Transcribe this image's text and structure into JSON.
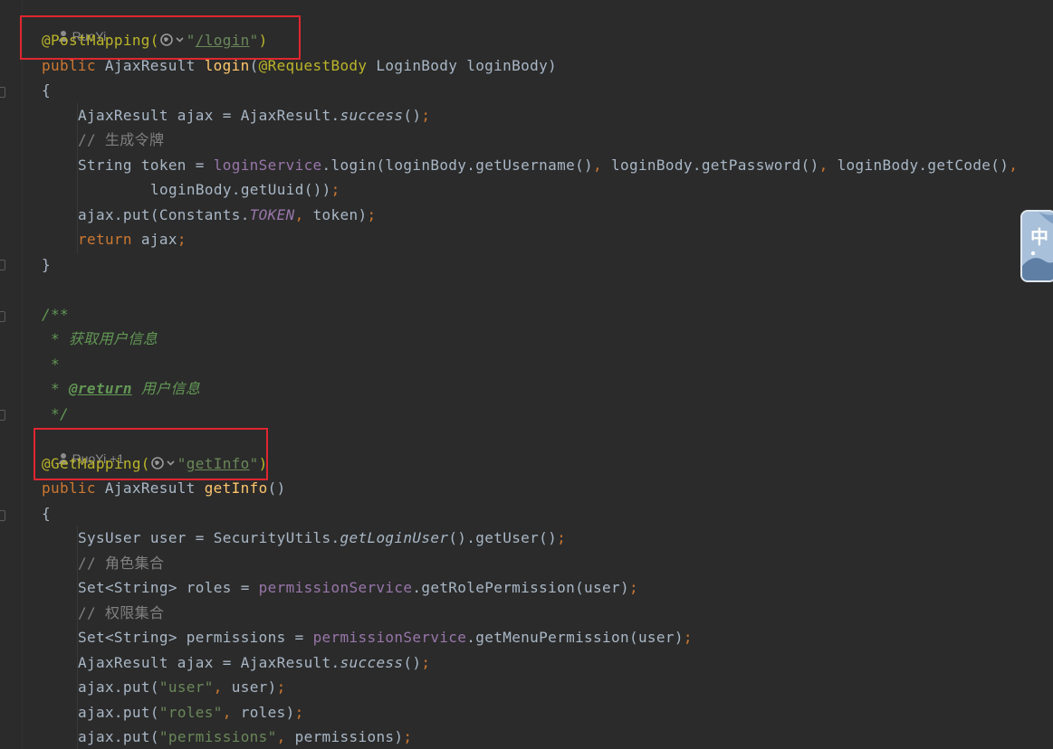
{
  "colors": {
    "background": "#2b2b2b",
    "annotation": "#bbb529",
    "keyword": "#cc7832",
    "method_decl": "#ffc66d",
    "string": "#6a8759",
    "field": "#9876aa",
    "comment": "#808080",
    "doc_comment": "#629755",
    "highlight_box": "#e0262f"
  },
  "icons": {
    "author": "person-icon",
    "endpoint": "globe-dropdown-icon",
    "ime": "input-method-icon"
  },
  "authors": {
    "login_method": "RuoYi",
    "getinfo_method": "RuoYi +1"
  },
  "code": {
    "l_login_post": "@PostMapping(",
    "l_login_url": "/login",
    "l_login_sig_kw": "public",
    "l_login_sig_type": " AjaxResult ",
    "l_login_sig_name": "login",
    "l_login_sig_paren": "(",
    "l_login_sig_ann": "@RequestBody",
    "l_login_sig_rest": " LoginBody loginBody)",
    "l_open1": "{",
    "l_ajax1_a": "AjaxResult ajax = AjaxResult.",
    "l_ajax1_b": "success",
    "l_ajax1_c": "()",
    "l_cmt_token": "// 生成令牌",
    "l_token_a": "String token = ",
    "l_token_field": "loginService",
    "l_token_b": ".login(loginBody.getUsername()",
    "l_token_c": " loginBody.getPassword()",
    "l_token_d": " loginBody.getCode()",
    "l_token_cont": "loginBody.getUuid())",
    "l_put_token_a": "ajax.put(Constants.",
    "l_put_token_const": "TOKEN",
    "l_put_token_b": " token)",
    "l_return_kw": "return",
    "l_return_b": " ajax",
    "l_close1": "}",
    "l_doc_open": "/**",
    "l_doc_desc": " * 获取用户信息",
    "l_doc_blank": " *",
    "l_doc_return_star": " * ",
    "l_doc_return_tag": "@return",
    "l_doc_return_text": " 用户信息",
    "l_doc_close": " */",
    "l_get_ann": "@GetMapping(",
    "l_get_url": "getInfo",
    "l_get_sig_kw": "public",
    "l_get_sig_type": " AjaxResult ",
    "l_get_sig_name": "getInfo",
    "l_get_sig_rest": "()",
    "l_open2": "{",
    "l_user_a": "SysUser user = SecurityUtils.",
    "l_user_b": "getLoginUser",
    "l_user_c": "().getUser()",
    "l_cmt_roles": "// 角色集合",
    "l_roles_a": "Set<String> roles = ",
    "l_roles_field": "permissionService",
    "l_roles_b": ".getRolePermission(user)",
    "l_cmt_perms": "// 权限集合",
    "l_perms_a": "Set<String> permissions = ",
    "l_perms_field": "permissionService",
    "l_perms_b": ".getMenuPermission(user)",
    "l_ajax2_a": "AjaxResult ajax = AjaxResult.",
    "l_ajax2_b": "success",
    "l_ajax2_c": "()",
    "l_put_user_a": "ajax.put(",
    "l_put_user_s": "\"user\"",
    "l_put_user_b": " user)",
    "l_put_roles_a": "ajax.put(",
    "l_put_roles_s": "\"roles\"",
    "l_put_roles_b": " roles)",
    "l_put_perms_a": "ajax.put(",
    "l_put_perms_s": "\"permissions\"",
    "l_put_perms_b": " permissions)"
  },
  "ime": {
    "char": "中"
  }
}
